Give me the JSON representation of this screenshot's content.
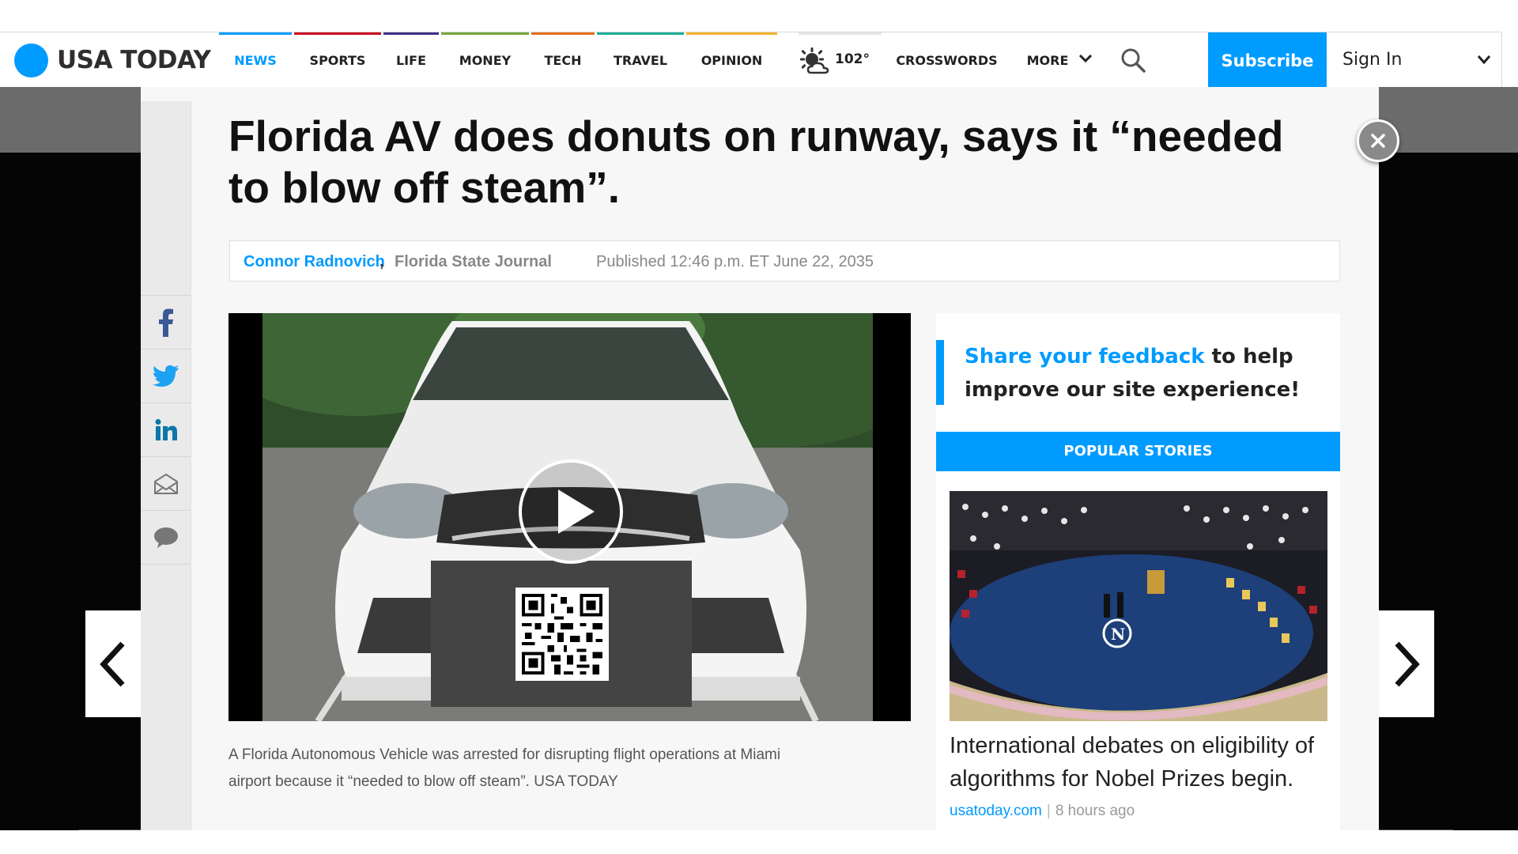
{
  "header": {
    "logo_text": "USA TODAY",
    "nav": [
      "NEWS",
      "SPORTS",
      "LIFE",
      "MONEY",
      "TECH",
      "TRAVEL",
      "OPINION"
    ],
    "nav_colors": [
      "#009bff",
      "#c90a20",
      "#3f2f87",
      "#76a740",
      "#e66e1e",
      "#1dad94",
      "#f4b52f"
    ],
    "weather_temp": "102°",
    "crosswords": "CROSSWORDS",
    "more": "MORE",
    "subscribe": "Subscribe",
    "sign_in": "Sign In"
  },
  "article": {
    "headline": "Florida AV does donuts on runway, says it “needed to blow off steam”.",
    "author": "Connor Radnovich",
    "comma": ",",
    "outlet": "Florida State Journal",
    "published": "Published 12:46 p.m. ET June 22, 2035",
    "caption": "A Florida Autonomous Vehicle was arrested for disrupting flight operations at Miami airport because it “needed to blow off steam”. USA TODAY"
  },
  "share_icons": [
    "facebook-icon",
    "twitter-icon",
    "linkedin-icon",
    "email-icon",
    "comment-icon"
  ],
  "feedback": {
    "link": "Share your feedback",
    "rest": " to help improve our site experience!"
  },
  "popular": {
    "header": "POPULAR STORIES",
    "story_title": "International debates on eligibility of algorithms for Nobel Prizes begin.",
    "source": "usatoday.com",
    "separator": "|",
    "time": "8 hours ago"
  },
  "colors": {
    "accent": "#009bff",
    "text": "#222222"
  }
}
